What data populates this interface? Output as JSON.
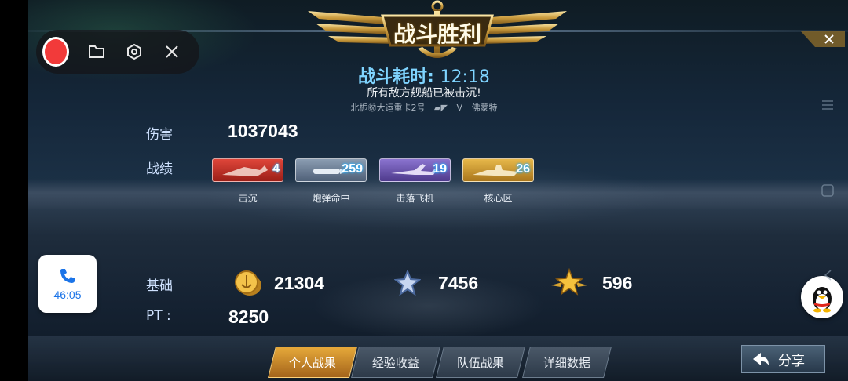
{
  "banner": {
    "title": "战斗胜利"
  },
  "battle": {
    "time_label": "战斗耗时:",
    "time_value": "12:18",
    "result_text": "所有敌方舰船已被击沉!",
    "ship_left": "北栀㊗大运重卡2号",
    "vs": "V",
    "ship_right": "佛蒙特"
  },
  "stats": {
    "damage_label": "伤害",
    "damage_value": "1037043",
    "record_label": "战绩",
    "medals": [
      {
        "name": "击沉",
        "count": "4",
        "icon": "sinking-ship-icon",
        "color": "#c8322a"
      },
      {
        "name": "炮弹命中",
        "count": "259",
        "icon": "shell-icon",
        "color": "#6a7d95"
      },
      {
        "name": "击落飞机",
        "count": "19",
        "icon": "aircraft-icon",
        "color": "#6b55a8"
      },
      {
        "name": "核心区",
        "count": "26",
        "icon": "citadel-icon",
        "color": "#c9962a"
      }
    ]
  },
  "rewards": {
    "base_label": "基础",
    "coins": "21304",
    "exp": "7456",
    "rank_points": "596",
    "pt_label": "PT :",
    "pt_value": "8250"
  },
  "tabs": [
    {
      "label": "个人战果",
      "active": true
    },
    {
      "label": "经验收益",
      "active": false
    },
    {
      "label": "队伍战果",
      "active": false
    },
    {
      "label": "详细数据",
      "active": false
    }
  ],
  "share": {
    "label": "分享"
  },
  "call": {
    "duration": "46:05"
  },
  "colors": {
    "accent": "#7fd4ff",
    "tab_active": "#e6a93a",
    "record": "#f23a3a"
  }
}
